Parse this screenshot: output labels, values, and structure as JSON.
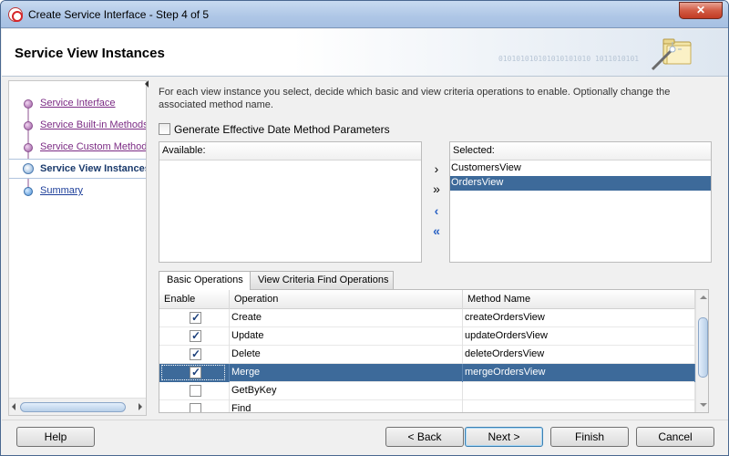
{
  "window": {
    "title": "Create Service Interface - Step 4 of 5",
    "close_label": "✕"
  },
  "header": {
    "title": "Service View Instances",
    "binary_text": "010101010101010101010 1011010101"
  },
  "nav": {
    "items": [
      {
        "label": "Service Interface",
        "state": "visited"
      },
      {
        "label": "Service Built-in Methods",
        "state": "visited"
      },
      {
        "label": "Service Custom Methods",
        "state": "visited"
      },
      {
        "label": "Service View Instances",
        "state": "current"
      },
      {
        "label": "Summary",
        "state": "next"
      }
    ]
  },
  "main": {
    "instructions": "For each view instance you select, decide which basic and view criteria operations to enable. Optionally change the associated method name.",
    "effective_date_checkbox": {
      "label": "Generate Effective Date Method Parameters",
      "checked": false
    },
    "available": {
      "label": "Available:",
      "items": []
    },
    "selected": {
      "label": "Selected:",
      "items": [
        {
          "label": "CustomersView",
          "selected": false
        },
        {
          "label": "OrdersView",
          "selected": true
        }
      ]
    },
    "shuttle_buttons": {
      "move": "›",
      "move_all": "»",
      "remove": "‹",
      "remove_all": "«"
    },
    "tabs": [
      {
        "label": "Basic Operations",
        "active": true
      },
      {
        "label": "View Criteria Find Operations",
        "active": false
      }
    ],
    "grid": {
      "columns": [
        "Enable",
        "Operation",
        "Method Name"
      ],
      "rows": [
        {
          "enabled": true,
          "operation": "Create",
          "method": "createOrdersView",
          "selected": false
        },
        {
          "enabled": true,
          "operation": "Update",
          "method": "updateOrdersView",
          "selected": false
        },
        {
          "enabled": true,
          "operation": "Delete",
          "method": "deleteOrdersView",
          "selected": false
        },
        {
          "enabled": true,
          "operation": "Merge",
          "method": "mergeOrdersView",
          "selected": true
        },
        {
          "enabled": false,
          "operation": "GetByKey",
          "method": "",
          "selected": false
        },
        {
          "enabled": false,
          "operation": "Find",
          "method": "",
          "selected": false
        }
      ]
    }
  },
  "footer": {
    "help": "Help",
    "back": "< Back",
    "next": "Next >",
    "finish": "Finish",
    "cancel": "Cancel"
  },
  "colors": {
    "selection": "#3d6a9a",
    "nav_visited": "#7b2b84",
    "nav_current": "#1a3a6c"
  }
}
